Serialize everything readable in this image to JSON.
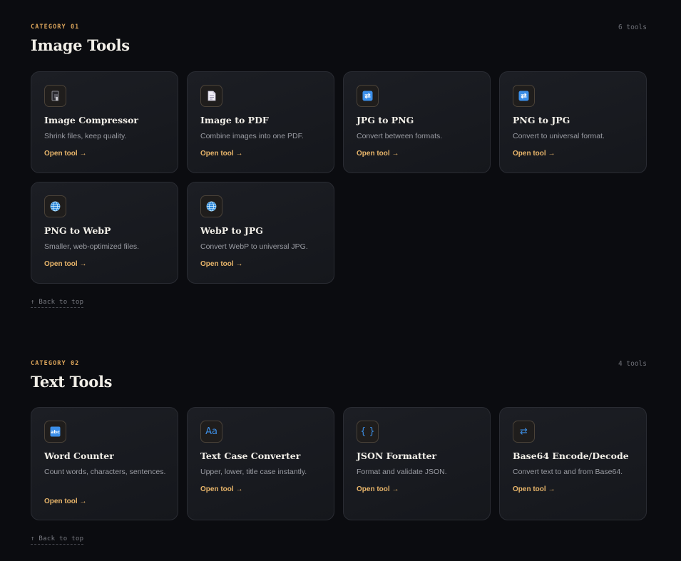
{
  "sections": [
    {
      "category_label": "CATEGORY 01",
      "count": "6 tools",
      "title": "Image Tools",
      "back_to_top": "↑ Back to top",
      "tools": [
        {
          "icon": "compress-icon",
          "title": "Image Compressor",
          "desc": "Shrink files, keep quality.",
          "link": "Open tool →"
        },
        {
          "icon": "document-icon",
          "title": "Image to PDF",
          "desc": "Combine images into one PDF.",
          "link": "Open tool →"
        },
        {
          "icon": "convert-icon",
          "title": "JPG to PNG",
          "desc": "Convert between formats.",
          "link": "Open tool →"
        },
        {
          "icon": "convert-icon",
          "title": "PNG to JPG",
          "desc": "Convert to universal format.",
          "link": "Open tool →"
        },
        {
          "icon": "globe-icon",
          "title": "PNG to WebP",
          "desc": "Smaller, web-optimized files.",
          "link": "Open tool →"
        },
        {
          "icon": "globe-icon",
          "title": "WebP to JPG",
          "desc": "Convert WebP to universal JPG.",
          "link": "Open tool →"
        }
      ]
    },
    {
      "category_label": "CATEGORY 02",
      "count": "4 tools",
      "title": "Text Tools",
      "back_to_top": "↑ Back to top",
      "tools": [
        {
          "icon": "abc-icon",
          "title": "Word Counter",
          "desc": "Count words, characters, sentences.",
          "link": "Open tool →"
        },
        {
          "icon": "text-case-icon",
          "glyph": "Aa",
          "title": "Text Case Converter",
          "desc": "Upper, lower, title case instantly.",
          "link": "Open tool →"
        },
        {
          "icon": "braces-icon",
          "glyph": "{ }",
          "title": "JSON Formatter",
          "desc": "Format and validate JSON.",
          "link": "Open tool →"
        },
        {
          "icon": "swap-arrows-icon",
          "glyph": "⇄",
          "title": "Base64 Encode/Decode",
          "desc": "Convert text to and from Base64.",
          "link": "Open tool →"
        }
      ]
    }
  ],
  "colors": {
    "background": "#0b0c10",
    "accent": "#e8b56a",
    "category_label": "#d9a35a",
    "icon_blue": "#3d8fe6"
  }
}
